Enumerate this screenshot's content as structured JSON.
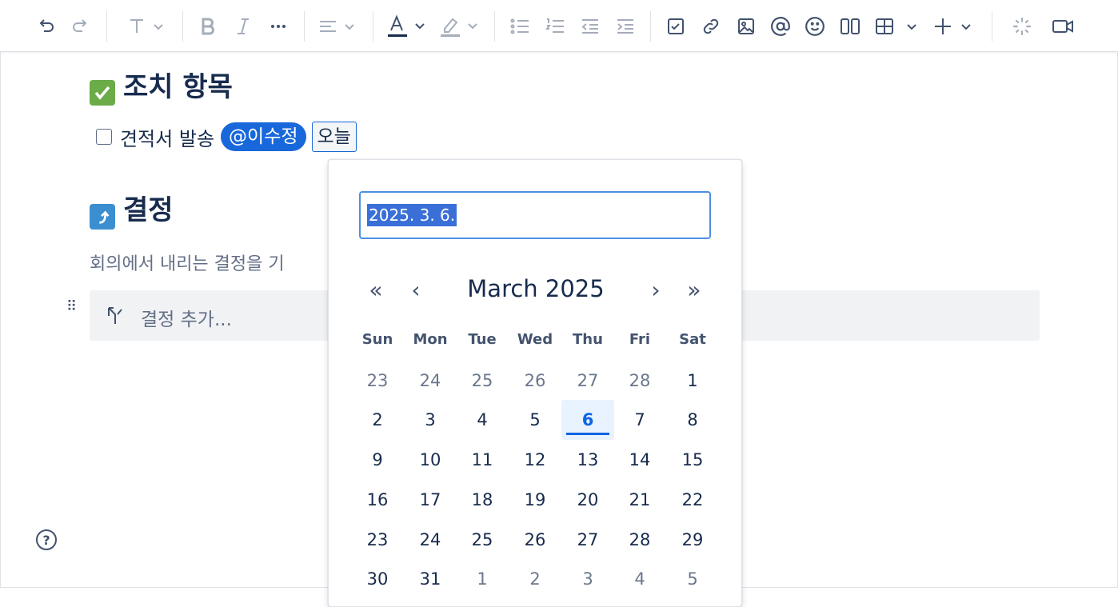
{
  "toolbar": {
    "icons": [
      "undo-icon",
      "redo-icon",
      "text-style-icon",
      "bold-icon",
      "italic-icon",
      "more-icon",
      "align-icon",
      "text-color-icon",
      "highlight-icon",
      "bullet-list-icon",
      "numbered-list-icon",
      "outdent-icon",
      "indent-icon",
      "task-icon",
      "link-icon",
      "image-icon",
      "mention-icon",
      "emoji-icon",
      "layout-icon",
      "table-icon",
      "insert-icon",
      "ai-icon",
      "video-icon"
    ]
  },
  "action_items": {
    "heading": "조치 항목",
    "task": {
      "text": "견적서 발송",
      "mention": "@이수정",
      "date": "오늘"
    }
  },
  "decisions": {
    "heading": "결정",
    "description": "회의에서 내리는 결정을 기",
    "placeholder": "결정 추가..."
  },
  "date_picker": {
    "input_value": "2025. 3. 6.",
    "month_label": "March 2025",
    "weekdays": [
      "Sun",
      "Mon",
      "Tue",
      "Wed",
      "Thu",
      "Fri",
      "Sat"
    ],
    "weeks": [
      [
        "23",
        "24",
        "25",
        "26",
        "27",
        "28",
        "1"
      ],
      [
        "2",
        "3",
        "4",
        "5",
        "6",
        "7",
        "8"
      ],
      [
        "9",
        "10",
        "11",
        "12",
        "13",
        "14",
        "15"
      ],
      [
        "16",
        "17",
        "18",
        "19",
        "20",
        "21",
        "22"
      ],
      [
        "23",
        "24",
        "25",
        "26",
        "27",
        "28",
        "29"
      ],
      [
        "30",
        "31",
        "1",
        "2",
        "3",
        "4",
        "5"
      ]
    ],
    "selected_day": "6",
    "nav": {
      "prev_year": "«",
      "prev_month": "‹",
      "next_month": "›",
      "next_year": "»"
    }
  },
  "help": {
    "label": "?"
  },
  "colors": {
    "accent": "#1868db",
    "check_green": "#6bab48",
    "decision_blue": "#3b8fd0"
  }
}
